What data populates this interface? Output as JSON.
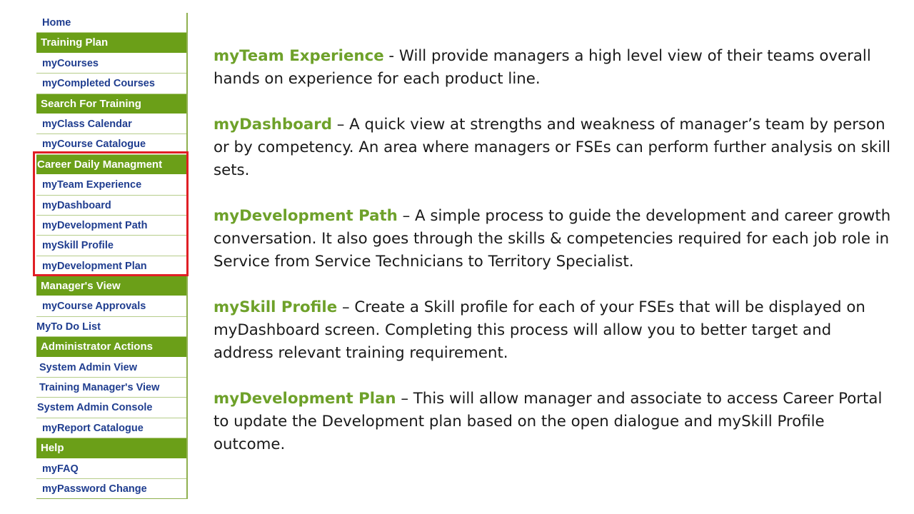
{
  "sidebar": {
    "home": "Home",
    "training_plan": "Training Plan",
    "my_courses": "myCourses",
    "my_completed_courses": "myCompleted Courses",
    "search_for_training": "Search For Training",
    "my_class_calendar": "myClass Calendar",
    "my_course_catalogue": "myCourse Catalogue",
    "career_daily_managment": "Career Daily Managment",
    "my_team_experience": "myTeam Experience",
    "my_dashboard": "myDashboard",
    "my_development_path": "myDevelopment Path",
    "my_skill_profile": "mySkill Profile",
    "my_development_plan": "myDevelopment Plan",
    "managers_view": "Manager's View",
    "my_course_approvals": "myCourse Approvals",
    "my_to_do_list": "MyTo Do List",
    "administrator_actions": "Administrator Actions",
    "system_admin_view": "System Admin View",
    "training_managers_view": "Training Manager's View",
    "system_admin_console": "System Admin Console",
    "my_report_catalogue": "myReport Catalogue",
    "help": "Help",
    "my_faq": "myFAQ",
    "my_password_change": "myPassword Change"
  },
  "content": {
    "items": [
      {
        "term": "myTeam Experience",
        "text": " - Will provide managers a high level view of their teams overall hands on experience for each product line."
      },
      {
        "term": "myDashboard",
        "text": " – A quick view at strengths and weakness of manager’s team by person or by competency. An area where managers or FSEs can perform further analysis on skill sets."
      },
      {
        "term": "myDevelopment Path",
        "text": " – A simple process to guide the development and career growth conversation. It also goes through the skills & competencies required for each job role in Service from Service Technicians to Territory Specialist."
      },
      {
        "term": "mySkill Profile",
        "text": " – Create a Skill profile for each of your FSEs that will be displayed on myDashboard screen. Completing this process will allow you to better target and address relevant training requirement."
      },
      {
        "term": "myDevelopment Plan",
        "text": " – This will allow manager and associate to access Career Portal to update the Development plan based on the open dialogue and mySkill Profile outcome."
      }
    ]
  },
  "colors": {
    "header_green": "#6b9f18",
    "term_green": "#6ea12a",
    "link_blue": "#1f3d8f",
    "highlight_red": "#e01f25"
  }
}
